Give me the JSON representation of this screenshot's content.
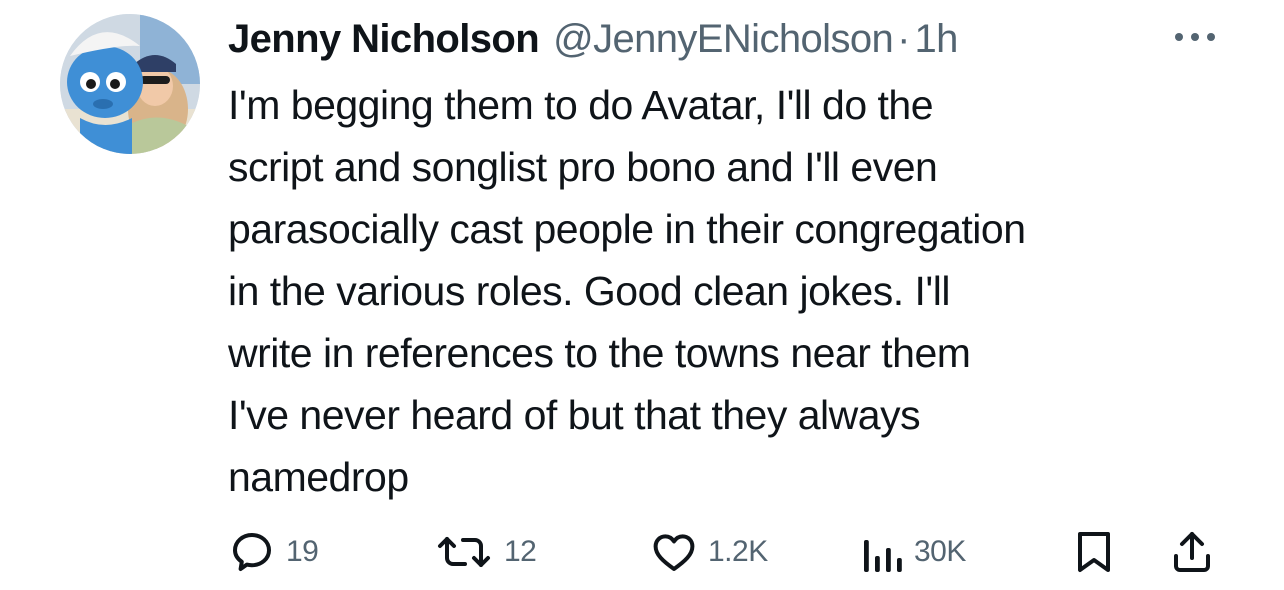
{
  "author": {
    "name": "Jenny Nicholson",
    "handle": "@JennyENicholson",
    "separator": "·",
    "time": "1h"
  },
  "tweet": {
    "lines": [
      "I'm begging them to do Avatar, I'll do the",
      "script and songlist pro bono and I'll even",
      "parasocially cast people in their congregation",
      "in the various roles. Good clean jokes. I'll",
      "write in references to the towns near them",
      "I've never heard of but that they always",
      "namedrop"
    ]
  },
  "actions": {
    "replies": "19",
    "reposts": "12",
    "likes": "1.2K",
    "views": "30K"
  },
  "icons": {
    "more": "more-horizontal-icon",
    "reply": "reply-icon",
    "repost": "repost-icon",
    "like": "heart-icon",
    "views": "views-chart-icon",
    "bookmark": "bookmark-icon",
    "share": "share-icon"
  },
  "colors": {
    "text": "#0f1419",
    "secondary": "#536471",
    "background": "#ffffff"
  }
}
